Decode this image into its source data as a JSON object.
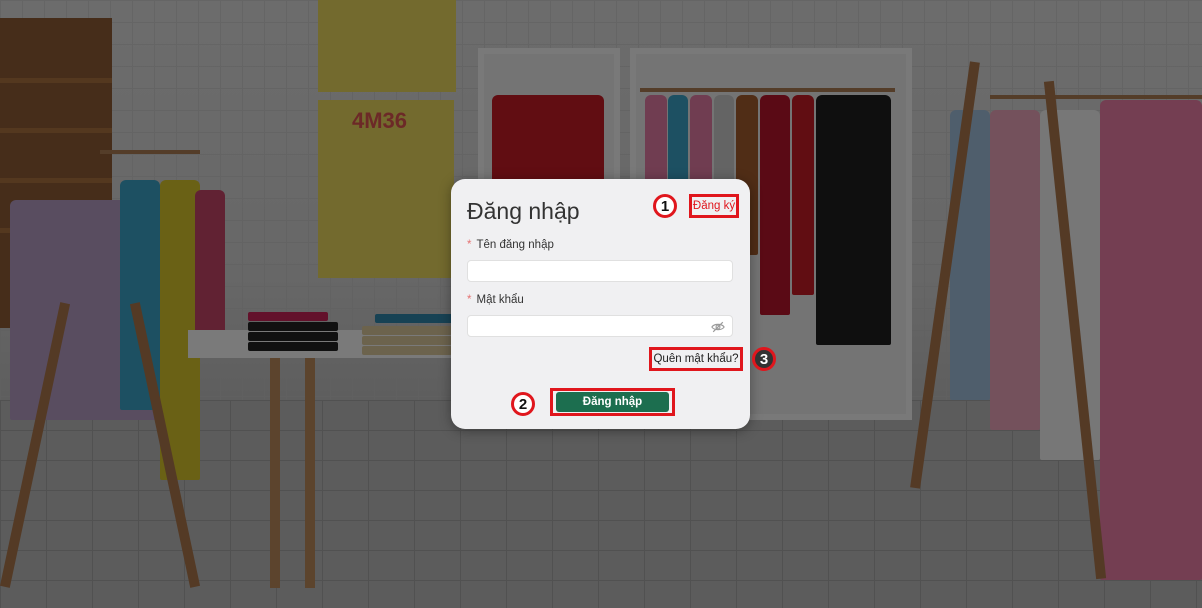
{
  "login_dialog": {
    "title": "Đăng nhập",
    "register_link": "Đăng ký",
    "username": {
      "label": "Tên đăng nhập",
      "value": "",
      "placeholder": ""
    },
    "password": {
      "label": "Mật khẩu",
      "value": "",
      "placeholder": ""
    },
    "forgot_link": "Quên mật khẩu?",
    "submit_label": "Đăng nhập",
    "required_marker": "*"
  },
  "step_markers": [
    "1",
    "2",
    "3"
  ],
  "background": {
    "poster_text": "4M36"
  },
  "colors": {
    "accent_red": "#e0161d",
    "primary_green": "#1c6e4f",
    "dialog_bg": "#f0f0f2"
  },
  "icons": {
    "password_toggle": "eye-slash-icon"
  }
}
